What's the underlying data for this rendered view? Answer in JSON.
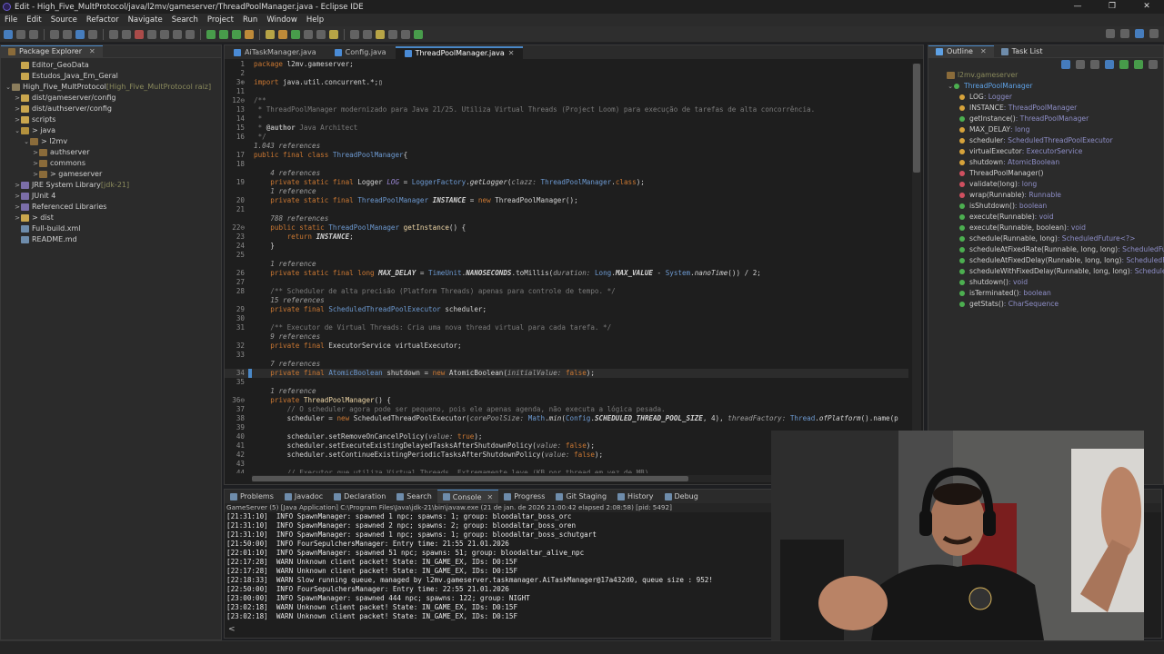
{
  "window": {
    "title": "Edit - High_Five_MultProtocol/java/l2mv/gameserver/ThreadPoolManager.java - Eclipse IDE",
    "minimize": "—",
    "restore": "❐",
    "close": "✕"
  },
  "menu": [
    "File",
    "Edit",
    "Source",
    "Refactor",
    "Navigate",
    "Search",
    "Project",
    "Run",
    "Window",
    "Help"
  ],
  "package_explorer": {
    "tabs": [
      {
        "label": "Package Explorer"
      }
    ],
    "items": [
      {
        "indent": 1,
        "tw": "",
        "icon": "folder",
        "label": "Editor_GeoData",
        "suffix": ""
      },
      {
        "indent": 1,
        "tw": "",
        "icon": "folder",
        "label": "Estudos_Java_Em_Geral",
        "suffix": ""
      },
      {
        "indent": 0,
        "tw": "⌄",
        "icon": "proj",
        "label": "High_Five_MultProtocol",
        "suffix": " [High_Five_MultProtocol raiz]"
      },
      {
        "indent": 1,
        "tw": ">",
        "icon": "folder",
        "label": "dist/gameserver/config",
        "suffix": ""
      },
      {
        "indent": 1,
        "tw": ">",
        "icon": "folder",
        "label": "dist/authserver/config",
        "suffix": ""
      },
      {
        "indent": 1,
        "tw": ">",
        "icon": "folder",
        "label": "scripts",
        "suffix": ""
      },
      {
        "indent": 1,
        "tw": "⌄",
        "icon": "src",
        "label": "> java",
        "suffix": ""
      },
      {
        "indent": 2,
        "tw": "⌄",
        "icon": "pkg",
        "label": "> l2mv",
        "suffix": ""
      },
      {
        "indent": 3,
        "tw": ">",
        "icon": "pkg",
        "label": "authserver",
        "suffix": ""
      },
      {
        "indent": 3,
        "tw": ">",
        "icon": "pkg",
        "label": "commons",
        "suffix": ""
      },
      {
        "indent": 3,
        "tw": ">",
        "icon": "pkg",
        "label": "> gameserver",
        "suffix": ""
      },
      {
        "indent": 1,
        "tw": ">",
        "icon": "lib",
        "label": "JRE System Library",
        "suffix": " [jdk-21]"
      },
      {
        "indent": 1,
        "tw": ">",
        "icon": "lib",
        "label": "JUnit 4",
        "suffix": ""
      },
      {
        "indent": 1,
        "tw": ">",
        "icon": "lib",
        "label": "Referenced Libraries",
        "suffix": ""
      },
      {
        "indent": 1,
        "tw": ">",
        "icon": "folder",
        "label": "> dist",
        "suffix": ""
      },
      {
        "indent": 1,
        "tw": "",
        "icon": "file",
        "label": "Full-build.xml",
        "suffix": ""
      },
      {
        "indent": 1,
        "tw": "",
        "icon": "file",
        "label": "README.md",
        "suffix": ""
      }
    ]
  },
  "editor": {
    "tabs": [
      {
        "label": "AiTaskManager.java",
        "active": false
      },
      {
        "label": "Config.java",
        "active": false
      },
      {
        "label": "ThreadPoolManager.java",
        "active": true
      }
    ],
    "lines": [
      {
        "n": "1",
        "html": "<span class='kw'>package</span> l2mv.gameserver;"
      },
      {
        "n": "2",
        "html": ""
      },
      {
        "n": "3⊕",
        "html": "<span class='kw'>import</span> java.util.concurrent.*;▯"
      },
      {
        "n": "11",
        "html": ""
      },
      {
        "n": "12⊖",
        "html": "<span class='cm'>/**</span>"
      },
      {
        "n": "13",
        "html": "<span class='cm'> * ThreadPoolManager modernizado para Java 21/25. Utiliza Virtual Threads (Project Loom) para execução de tarefas de alta concorrência.</span>"
      },
      {
        "n": "14",
        "html": "<span class='cm'> * </span>"
      },
      {
        "n": "15",
        "html": "<span class='cm'> * <b style='color:#b0b0b0'>@author</b> Java Architect</span>"
      },
      {
        "n": "16",
        "html": "<span class='cm'> */</span>"
      },
      {
        "n": "",
        "html": "<span class='ref'>1.043 references</span>"
      },
      {
        "n": "17",
        "html": "<span class='kw'>public final class</span> <span class='cls'>ThreadPoolManager</span>{"
      },
      {
        "n": "18",
        "html": ""
      },
      {
        "n": "",
        "html": "    <span class='ref'>4 references</span>"
      },
      {
        "n": "19",
        "html": "    <span class='kw'>private static final</span> Logger <span class='st'>LOG</span> = <span class='cls'>LoggerFactory</span>.<i>getLogger</i>(<span class='ref'>clazz:</span> <span class='cls'>ThreadPoolManager</span>.<span class='kw'>class</span>);"
      },
      {
        "n": "",
        "html": "    <span class='ref'>1 reference</span>"
      },
      {
        "n": "20",
        "html": "    <span class='kw'>private static final</span> <span class='cls'>ThreadPoolManager</span> <b><i>INSTANCE</i></b> = <span class='kw'>new</span> ThreadPoolManager();"
      },
      {
        "n": "21",
        "html": ""
      },
      {
        "n": "",
        "html": "    <span class='ref'>788 references</span>"
      },
      {
        "n": "22⊖",
        "html": "    <span class='kw'>public static</span> <span class='cls'>ThreadPoolManager</span> <span class='fld'>getInstance</span>() {"
      },
      {
        "n": "23",
        "html": "        <span class='kw'>return</span> <b><i>INSTANCE</i></b>;"
      },
      {
        "n": "24",
        "html": "    }"
      },
      {
        "n": "25",
        "html": ""
      },
      {
        "n": "",
        "html": "    <span class='ref'>1 reference</span>"
      },
      {
        "n": "26",
        "html": "    <span class='kw'>private static final long</span> <b><i>MAX_DELAY</i></b> = <span class='cls'>TimeUnit</span>.<b><i>NANOSECONDS</i></b>.toMillis(<span class='ref'>duration:</span> <span class='cls'>Long</span>.<b><i>MAX_VALUE</i></b> - <span class='cls'>System</span>.<i>nanoTime</i>()) / 2;"
      },
      {
        "n": "27",
        "html": ""
      },
      {
        "n": "28",
        "html": "    <span class='cm'>/** Scheduler de alta precisão (Platform Threads) apenas para controle de tempo. */</span>"
      },
      {
        "n": "",
        "html": "    <span class='ref'>15 references</span>"
      },
      {
        "n": "29",
        "html": "    <span class='kw'>private final</span> <span class='cls'>ScheduledThreadPoolExecutor</span> scheduler;"
      },
      {
        "n": "30",
        "html": ""
      },
      {
        "n": "31",
        "html": "    <span class='cm'>/** Executor de Virtual Threads: Cria uma nova thread virtual para cada tarefa. */</span>"
      },
      {
        "n": "",
        "html": "    <span class='ref'>9 references</span>"
      },
      {
        "n": "32",
        "html": "    <span class='kw'>private final</span> ExecutorService virtualExecutor;"
      },
      {
        "n": "33",
        "html": ""
      },
      {
        "n": "",
        "html": "    <span class='ref'>7 references</span>"
      },
      {
        "n": "34",
        "html": "    <span class='kw'>private final</span> <span class='cls'>AtomicBoolean</span> shutdown = <span class='kw'>new</span> AtomicBoolean(<span class='ref'>initialValue:</span> <span class='kw'>false</span>);",
        "hl": true
      },
      {
        "n": "35",
        "html": ""
      },
      {
        "n": "",
        "html": "    <span class='ref'>1 reference</span>"
      },
      {
        "n": "36⊖",
        "html": "    <span class='kw'>private</span> <span class='fld'>ThreadPoolManager</span>() {"
      },
      {
        "n": "37",
        "html": "        <span class='cm'>// O scheduler agora pode ser pequeno, pois ele apenas agenda, não executa a lógica pesada.</span>"
      },
      {
        "n": "38",
        "html": "        scheduler = <span class='kw'>new</span> ScheduledThreadPoolExecutor(<span class='ref'>corePoolSize:</span> <span class='cls'>Math</span>.<i>min</i>(<span class='cls'>Config</span>.<b><i>SCHEDULED_THREAD_POOL_SIZE</i></b>, 4), <span class='ref'>threadFactory:</span> <span class='cls'>Thread</span>.<i>ofPlatform</i>().name(p"
      },
      {
        "n": "39",
        "html": ""
      },
      {
        "n": "40",
        "html": "        scheduler.setRemoveOnCancelPolicy(<span class='ref'>value:</span> <span class='kw'>true</span>);"
      },
      {
        "n": "41",
        "html": "        scheduler.setExecuteExistingDelayedTasksAfterShutdownPolicy(<span class='ref'>value:</span> <span class='kw'>false</span>);"
      },
      {
        "n": "42",
        "html": "        scheduler.setContinueExistingPeriodicTasksAfterShutdownPolicy(<span class='ref'>value:</span> <span class='kw'>false</span>);"
      },
      {
        "n": "43",
        "html": ""
      },
      {
        "n": "44",
        "html": "        <span class='cm'>// Executor que utiliza Virtual Threads. Extremamente leve (KB por thread em vez de MB).</span>"
      }
    ]
  },
  "outline": {
    "tabs": [
      {
        "label": "Outline"
      },
      {
        "label": "Task List"
      }
    ],
    "package": "l2mv.gameserver",
    "class": "ThreadPoolManager",
    "members": [
      {
        "dot": "y",
        "name": "LOG",
        "type": " : Logger"
      },
      {
        "dot": "y",
        "name": "INSTANCE",
        "type": " : ThreadPoolManager"
      },
      {
        "dot": "g",
        "name": "getInstance()",
        "type": " : ThreadPoolManager"
      },
      {
        "dot": "y",
        "name": "MAX_DELAY",
        "type": " : long"
      },
      {
        "dot": "y",
        "name": "scheduler",
        "type": " : ScheduledThreadPoolExecutor"
      },
      {
        "dot": "y",
        "name": "virtualExecutor",
        "type": " : ExecutorService"
      },
      {
        "dot": "y",
        "name": "shutdown",
        "type": " : AtomicBoolean"
      },
      {
        "dot": "r",
        "name": "ThreadPoolManager()",
        "type": ""
      },
      {
        "dot": "r",
        "name": "validate(long)",
        "type": " : long"
      },
      {
        "dot": "r",
        "name": "wrap(Runnable)",
        "type": " : Runnable"
      },
      {
        "dot": "g",
        "name": "isShutdown()",
        "type": " : boolean"
      },
      {
        "dot": "g",
        "name": "execute(Runnable)",
        "type": " : void"
      },
      {
        "dot": "g",
        "name": "execute(Runnable, boolean)",
        "type": " : void"
      },
      {
        "dot": "g",
        "name": "schedule(Runnable, long)",
        "type": " : ScheduledFuture<?>"
      },
      {
        "dot": "g",
        "name": "scheduleAtFixedRate(Runnable, long, long)",
        "type": " : ScheduledFutu"
      },
      {
        "dot": "g",
        "name": "scheduleAtFixedDelay(Runnable, long, long)",
        "type": " : ScheduledFutu"
      },
      {
        "dot": "g",
        "name": "scheduleWithFixedDelay(Runnable, long, long)",
        "type": " : ScheduledFu"
      },
      {
        "dot": "g",
        "name": "shutdown()",
        "type": " : void"
      },
      {
        "dot": "g",
        "name": "isTerminated()",
        "type": " : boolean"
      },
      {
        "dot": "g",
        "name": "getStats()",
        "type": " : CharSequence"
      }
    ]
  },
  "console": {
    "tabs": [
      {
        "label": "Problems",
        "active": false
      },
      {
        "label": "Javadoc",
        "active": false
      },
      {
        "label": "Declaration",
        "active": false
      },
      {
        "label": "Search",
        "active": false
      },
      {
        "label": "Console",
        "active": true
      },
      {
        "label": "Progress",
        "active": false
      },
      {
        "label": "Git Staging",
        "active": false
      },
      {
        "label": "History",
        "active": false
      },
      {
        "label": "Debug",
        "active": false
      }
    ],
    "header": "GameServer (5) [Java Application] C:\\Program Files\\Java\\jdk-21\\bin\\javaw.exe  (21 de jan. de 2026 21:00:42 elapsed 2:08:58) [pid: 5492]",
    "lines": [
      "[21:31:10]  INFO SpawnManager: spawned 1 npc; spawns: 1; group: bloodaltar_boss_orc",
      "[21:31:10]  INFO SpawnManager: spawned 2 npc; spawns: 2; group: bloodaltar_boss_oren",
      "[21:31:10]  INFO SpawnManager: spawned 1 npc; spawns: 1; group: bloodaltar_boss_schutgart",
      "[21:50:00]  INFO FourSepulchersManager: Entry time: 21:55 21.01.2026",
      "[22:01:10]  INFO SpawnManager: spawned 51 npc; spawns: 51; group: bloodaltar_alive_npc",
      "[22:17:28]  WARN Unknown client packet! State: IN_GAME_EX, IDs: D0:15F",
      "[22:17:28]  WARN Unknown client packet! State: IN_GAME_EX, IDs: D0:15F",
      "[22:18:33]  WARN Slow running queue, managed by l2mv.gameserver.taskmanager.AiTaskManager@17a432d0, queue size : 952!",
      "[22:50:00]  INFO FourSepulchersManager: Entry time: 22:55 21.01.2026",
      "[23:00:00]  INFO SpawnManager: spawned 444 npc; spawns: 122; group: NIGHT",
      "[23:02:18]  WARN Unknown client packet! State: IN_GAME_EX, IDs: D0:15F",
      "[23:02:18]  WARN Unknown client packet! State: IN_GAME_EX, IDs: D0:15F"
    ],
    "prompt": "<"
  }
}
